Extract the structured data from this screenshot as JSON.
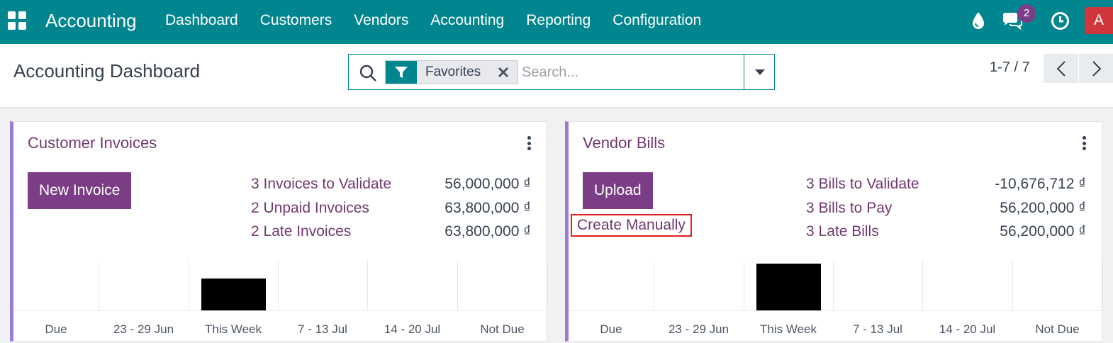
{
  "navbar": {
    "app_title": "Accounting",
    "menu": [
      "Dashboard",
      "Customers",
      "Vendors",
      "Accounting",
      "Reporting",
      "Configuration"
    ],
    "chat_badge": "2",
    "avatar_initial": "A",
    "icons": [
      "apps-grid-icon",
      "droplet-icon",
      "chat-icon",
      "clock-icon"
    ]
  },
  "control_panel": {
    "title": "Accounting Dashboard",
    "facet_label": "Favorites",
    "search_placeholder": "Search...",
    "pager": "1-7 / 7"
  },
  "cards": [
    {
      "title": "Customer Invoices",
      "primary_button": "New Invoice",
      "stats": [
        {
          "label": "3 Invoices to Validate",
          "value": "56,000,000 ₫"
        },
        {
          "label": "2 Unpaid Invoices",
          "value": "63,800,000 ₫"
        },
        {
          "label": "2 Late Invoices",
          "value": "63,800,000 ₫"
        }
      ],
      "graph": {
        "categories": [
          "Due",
          "23 - 29 Jun",
          "This Week",
          "7 - 13 Jul",
          "14 - 20 Jul",
          "Not Due"
        ],
        "values": [
          0,
          0,
          0.64,
          0,
          0,
          0
        ]
      }
    },
    {
      "title": "Vendor Bills",
      "primary_button": "Upload",
      "secondary_link": "Create Manually",
      "stats": [
        {
          "label": "3 Bills to Validate",
          "value": "-10,676,712 ₫"
        },
        {
          "label": "3 Bills to Pay",
          "value": "56,200,000 ₫"
        },
        {
          "label": "3 Late Bills",
          "value": "56,200,000 ₫"
        }
      ],
      "graph": {
        "categories": [
          "Due",
          "23 - 29 Jun",
          "This Week",
          "7 - 13 Jul",
          "14 - 20 Jul",
          "Not Due"
        ],
        "values": [
          0,
          0,
          0.94,
          0,
          0,
          0
        ]
      }
    }
  ],
  "colors": {
    "navbar": "#01858f",
    "primary": "#7b3e86",
    "link": "#71386f",
    "card_accent": "#9d7ad5",
    "highlight": "#e02020",
    "avatar": "#d2363d"
  }
}
